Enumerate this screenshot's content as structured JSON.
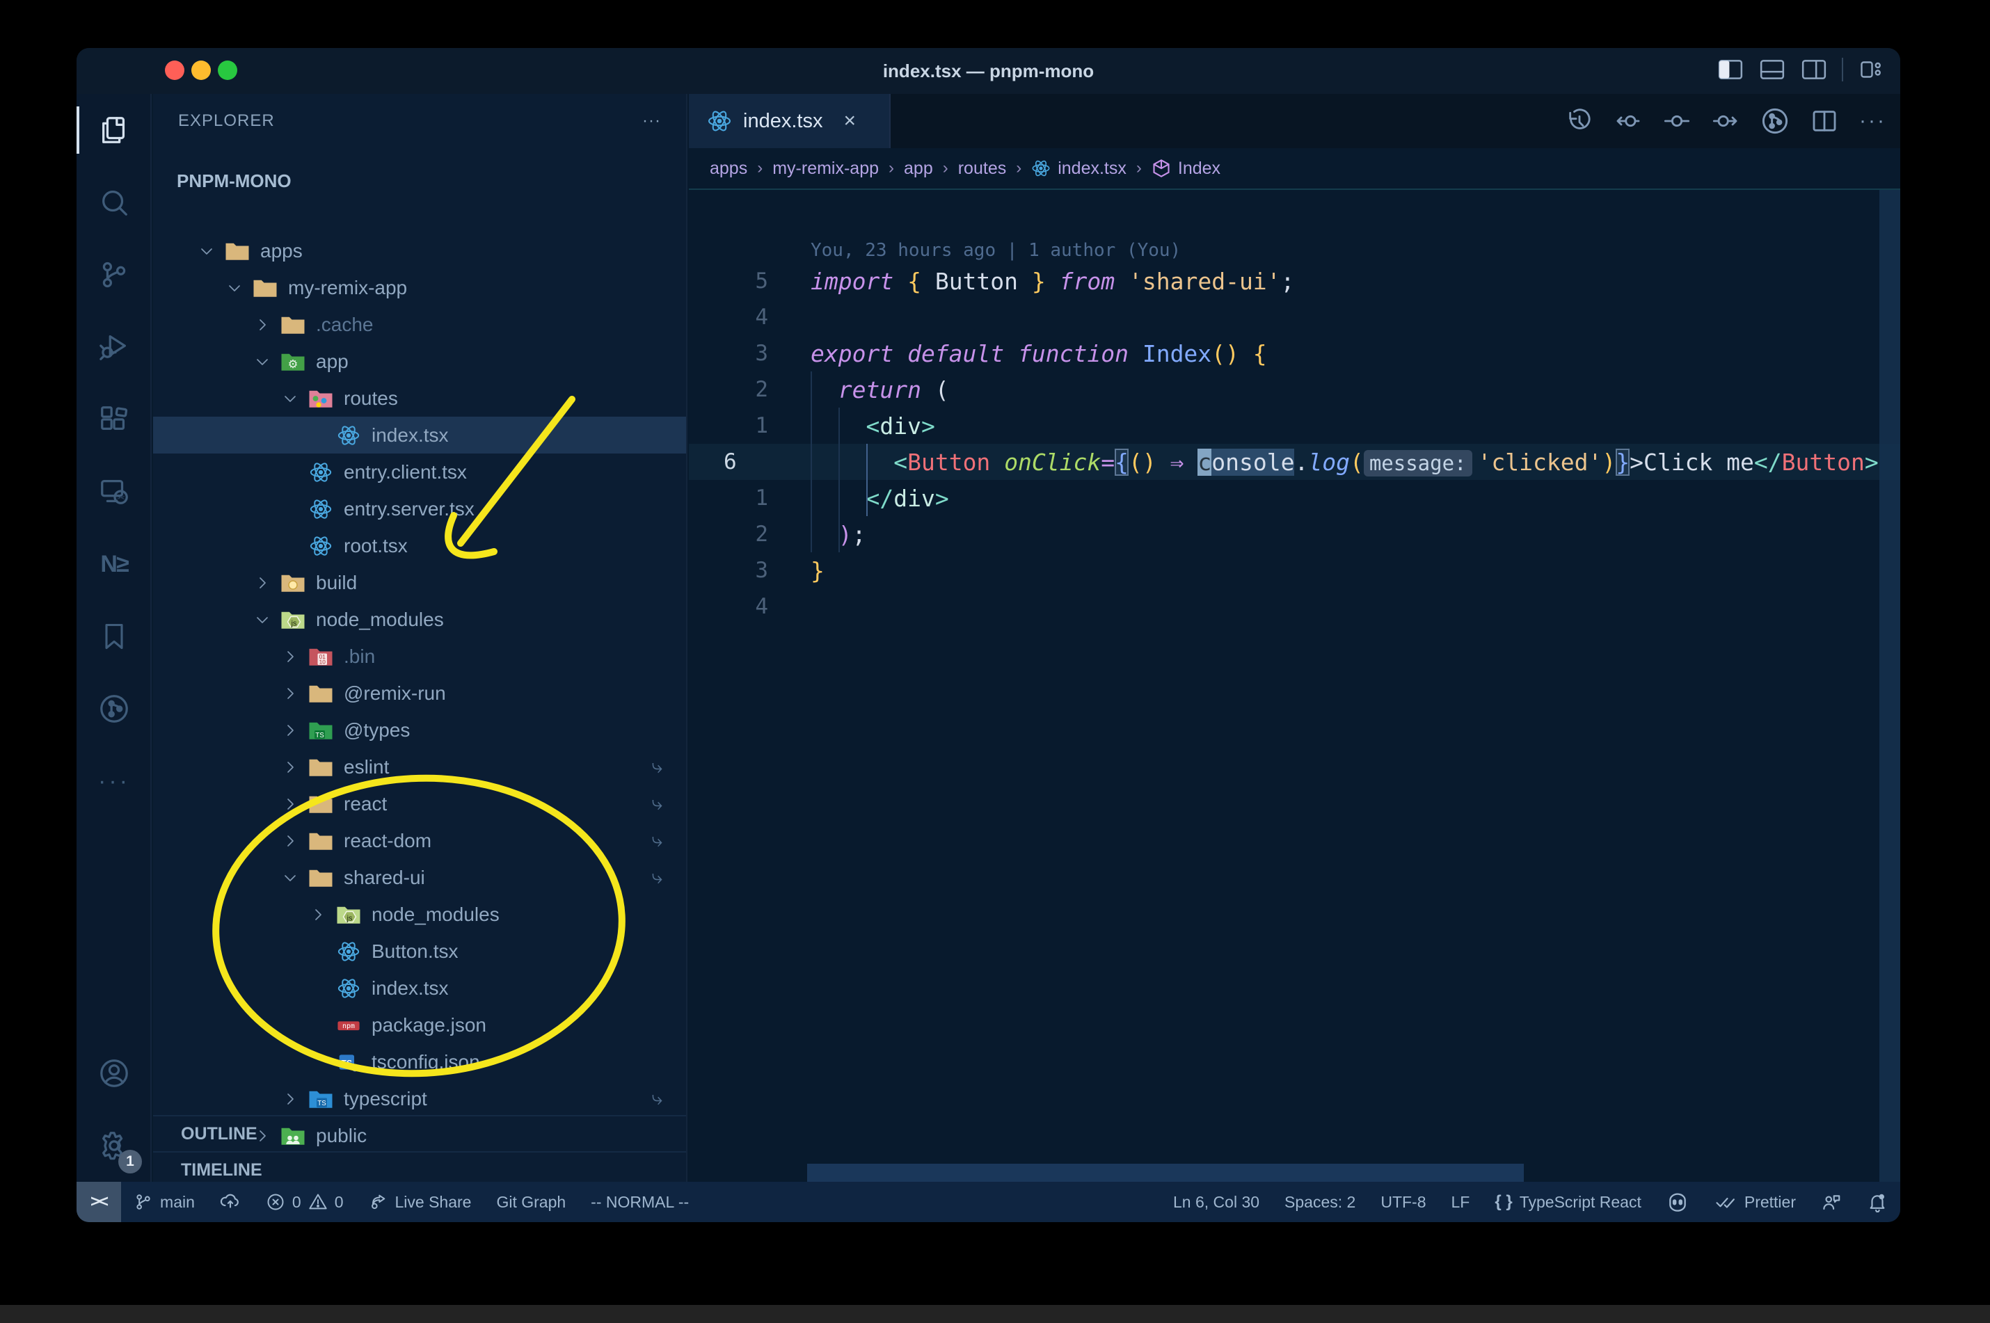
{
  "window": {
    "title": "index.tsx — pnpm-mono"
  },
  "colors": {
    "annotation_yellow": "#f5e61c",
    "react_blue": "#4aa8e0",
    "folder_tan": "#d9b77c",
    "keyword_magenta": "#c792ea",
    "string_orange": "#ecc48d",
    "function_blue": "#82aaff",
    "jsx_bracket_teal": "#7fdbca",
    "jsx_tag_salmon": "#f07178",
    "attribute_green": "#addb67",
    "bracket_gold": "#ffca5f",
    "selected_row_bg": "#1c3553",
    "status_bar_bg": "#0f2541"
  },
  "titlebar": {
    "layout_icons": [
      "toggle-sidebar-icon",
      "toggle-panel-icon",
      "toggle-secondary-sidebar-icon",
      "customize-layout-icon"
    ]
  },
  "activity_bar": {
    "top": [
      {
        "icon": "explorer-icon",
        "active": true
      },
      {
        "icon": "search-icon"
      },
      {
        "icon": "source-control-icon"
      },
      {
        "icon": "run-debug-icon"
      },
      {
        "icon": "extensions-icon"
      },
      {
        "icon": "remote-explorer-icon"
      },
      {
        "icon": "nx-console-icon"
      },
      {
        "icon": "bookmarks-icon"
      },
      {
        "icon": "git-graph-icon"
      },
      {
        "icon": "more-views-icon"
      }
    ],
    "bottom": [
      {
        "icon": "account-icon"
      },
      {
        "icon": "settings-gear-icon",
        "badge": "1"
      }
    ]
  },
  "sidebar": {
    "header": "EXPLORER",
    "header_more": "···",
    "root": "PNPM-MONO",
    "tree": [
      {
        "label": "apps",
        "depth": 1,
        "icon": "folder-tan",
        "chevron": "open"
      },
      {
        "label": "my-remix-app",
        "depth": 2,
        "icon": "folder-tan",
        "chevron": "open"
      },
      {
        "label": ".cache",
        "depth": 3,
        "icon": "folder-tan",
        "chevron": "closed",
        "dim": true
      },
      {
        "label": "app",
        "depth": 3,
        "icon": "folder-app",
        "chevron": "open"
      },
      {
        "label": "routes",
        "depth": 4,
        "icon": "folder-routes",
        "chevron": "open"
      },
      {
        "label": "index.tsx",
        "depth": 5,
        "icon": "react",
        "chevron": "none",
        "selected": true
      },
      {
        "label": "entry.client.tsx",
        "depth": 4,
        "icon": "react",
        "chevron": "none"
      },
      {
        "label": "entry.server.tsx",
        "depth": 4,
        "icon": "react",
        "chevron": "none"
      },
      {
        "label": "root.tsx",
        "depth": 4,
        "icon": "react",
        "chevron": "none"
      },
      {
        "label": "build",
        "depth": 3,
        "icon": "folder-build",
        "chevron": "closed"
      },
      {
        "label": "node_modules",
        "depth": 3,
        "icon": "folder-nm",
        "chevron": "open"
      },
      {
        "label": ".bin",
        "depth": 4,
        "icon": "folder-bin",
        "chevron": "closed",
        "dim": true
      },
      {
        "label": "@remix-run",
        "depth": 4,
        "icon": "folder-tan",
        "chevron": "closed"
      },
      {
        "label": "@types",
        "depth": 4,
        "icon": "folder-types",
        "chevron": "closed"
      },
      {
        "label": "eslint",
        "depth": 4,
        "icon": "folder-tan",
        "chevron": "closed",
        "symlink": true
      },
      {
        "label": "react",
        "depth": 4,
        "icon": "folder-tan",
        "chevron": "closed",
        "symlink": true
      },
      {
        "label": "react-dom",
        "depth": 4,
        "icon": "folder-tan",
        "chevron": "closed",
        "symlink": true
      },
      {
        "label": "shared-ui",
        "depth": 4,
        "icon": "folder-tan",
        "chevron": "open",
        "symlink": true
      },
      {
        "label": "node_modules",
        "depth": 5,
        "icon": "folder-nm",
        "chevron": "closed"
      },
      {
        "label": "Button.tsx",
        "depth": 5,
        "icon": "react",
        "chevron": "none"
      },
      {
        "label": "index.tsx",
        "depth": 5,
        "icon": "react",
        "chevron": "none"
      },
      {
        "label": "package.json",
        "depth": 5,
        "icon": "npm",
        "chevron": "none"
      },
      {
        "label": "tsconfig.json",
        "depth": 5,
        "icon": "tsconfig",
        "chevron": "none"
      },
      {
        "label": "typescript",
        "depth": 4,
        "icon": "folder-ts",
        "chevron": "closed",
        "symlink": true
      },
      {
        "label": "public",
        "depth": 3,
        "icon": "folder-public",
        "chevron": "closed"
      }
    ],
    "sections": [
      "OUTLINE",
      "TIMELINE"
    ]
  },
  "editor_group": {
    "tab": {
      "label": "index.tsx",
      "icon": "react",
      "close": "×"
    },
    "actions": [
      "timeline-history-icon",
      "commit-prev-icon",
      "commit-icon",
      "commit-next-icon",
      "git-graph-circle-icon",
      "split-editor-icon",
      "more-actions-icon"
    ],
    "breadcrumbs": [
      {
        "label": "apps"
      },
      {
        "label": "my-remix-app"
      },
      {
        "label": "app"
      },
      {
        "label": "routes"
      },
      {
        "label": "index.tsx",
        "icon": "react"
      },
      {
        "label": "Index",
        "icon": "symbol-cube"
      }
    ]
  },
  "editor": {
    "blame": "You, 23 hours ago | 1 author (You)",
    "cursor_overlay": "T",
    "lines": [
      {
        "rel": "5",
        "toks": [
          [
            "k",
            "import "
          ],
          [
            "y",
            "{"
          ],
          [
            "n",
            " Button "
          ],
          [
            "y",
            "}"
          ],
          [
            "n",
            " "
          ],
          [
            "k",
            "from "
          ],
          [
            "s",
            "'shared-ui'"
          ],
          [
            "n",
            ";"
          ]
        ]
      },
      {
        "rel": "4",
        "toks": []
      },
      {
        "rel": "3",
        "toks": [
          [
            "k",
            "export default function "
          ],
          [
            "f",
            "Index"
          ],
          [
            "y",
            "()"
          ],
          [
            "n",
            " "
          ],
          [
            "y",
            "{"
          ]
        ]
      },
      {
        "rel": "2",
        "toks": [
          [
            "n",
            "  "
          ],
          [
            "k",
            "return"
          ],
          [
            "n",
            " ("
          ]
        ]
      },
      {
        "rel": "1",
        "toks": [
          [
            "n",
            "    "
          ],
          [
            "t",
            "<"
          ],
          [
            "tw",
            "div"
          ],
          [
            "t",
            ">"
          ]
        ]
      },
      {
        "rel": "6",
        "current": true,
        "toks": [
          [
            "n",
            "      "
          ],
          [
            "t",
            "<"
          ],
          [
            "tag",
            "Button"
          ],
          [
            "n",
            " "
          ],
          [
            "at",
            "onClick"
          ],
          [
            "ar",
            "="
          ],
          [
            "bm",
            "{"
          ],
          [
            "y",
            "()"
          ],
          [
            "n",
            " "
          ],
          [
            "ar",
            "⇒"
          ],
          [
            "n",
            " "
          ],
          [
            "cur",
            "c"
          ],
          [
            "whl",
            "onsole"
          ],
          [
            "n",
            "."
          ],
          [
            "fi",
            "log"
          ],
          [
            "y",
            "("
          ],
          [
            "inl",
            "message:"
          ],
          [
            "s",
            "'clicked'"
          ],
          [
            "y",
            ")"
          ],
          [
            "bm",
            "}"
          ],
          [
            "n",
            ">"
          ],
          [
            "n",
            "Click me"
          ],
          [
            "t",
            "</"
          ],
          [
            "tag",
            "Button"
          ],
          [
            "t",
            ">"
          ]
        ]
      },
      {
        "rel": "1",
        "toks": [
          [
            "n",
            "    "
          ],
          [
            "t",
            "</"
          ],
          [
            "tw",
            "div"
          ],
          [
            "t",
            ">"
          ]
        ]
      },
      {
        "rel": "2",
        "toks": [
          [
            "n",
            "  "
          ],
          [
            "ar",
            ")"
          ],
          [
            "n",
            ";"
          ]
        ]
      },
      {
        "rel": "3",
        "toks": [
          [
            "y",
            "}"
          ]
        ]
      },
      {
        "rel": "4",
        "toks": []
      }
    ]
  },
  "status_bar": {
    "left": [
      {
        "name": "remote-indicator",
        "label": "><"
      },
      {
        "name": "branch",
        "icon": "branch-icon",
        "label": "main"
      },
      {
        "name": "sync",
        "icon": "cloud-upload-icon",
        "label": ""
      },
      {
        "name": "problems",
        "icon": "error-icon",
        "label": "0",
        "icon2": "warning-icon",
        "label2": "0"
      },
      {
        "name": "live-share",
        "icon": "live-share-icon",
        "label": "Live Share"
      },
      {
        "name": "git-graph",
        "label": "Git Graph"
      },
      {
        "name": "vim-mode",
        "label": "-- NORMAL --"
      }
    ],
    "right": [
      {
        "name": "cursor-position",
        "label": "Ln 6, Col 30"
      },
      {
        "name": "indentation",
        "label": "Spaces: 2"
      },
      {
        "name": "encoding",
        "label": "UTF-8"
      },
      {
        "name": "eol",
        "label": "LF"
      },
      {
        "name": "language-mode",
        "icon": "braces-icon",
        "label": "TypeScript React"
      },
      {
        "name": "copilot",
        "icon": "copilot-icon",
        "label": ""
      },
      {
        "name": "formatter",
        "icon": "double-check-icon",
        "label": "Prettier"
      },
      {
        "name": "feedback",
        "icon": "feedback-icon",
        "label": ""
      },
      {
        "name": "notifications",
        "icon": "bell-icon",
        "label": ""
      }
    ]
  },
  "annotations": {
    "color": "#f5e61c",
    "arrow_target": "node_modules",
    "ellipse_target": "shared-ui package contents"
  }
}
